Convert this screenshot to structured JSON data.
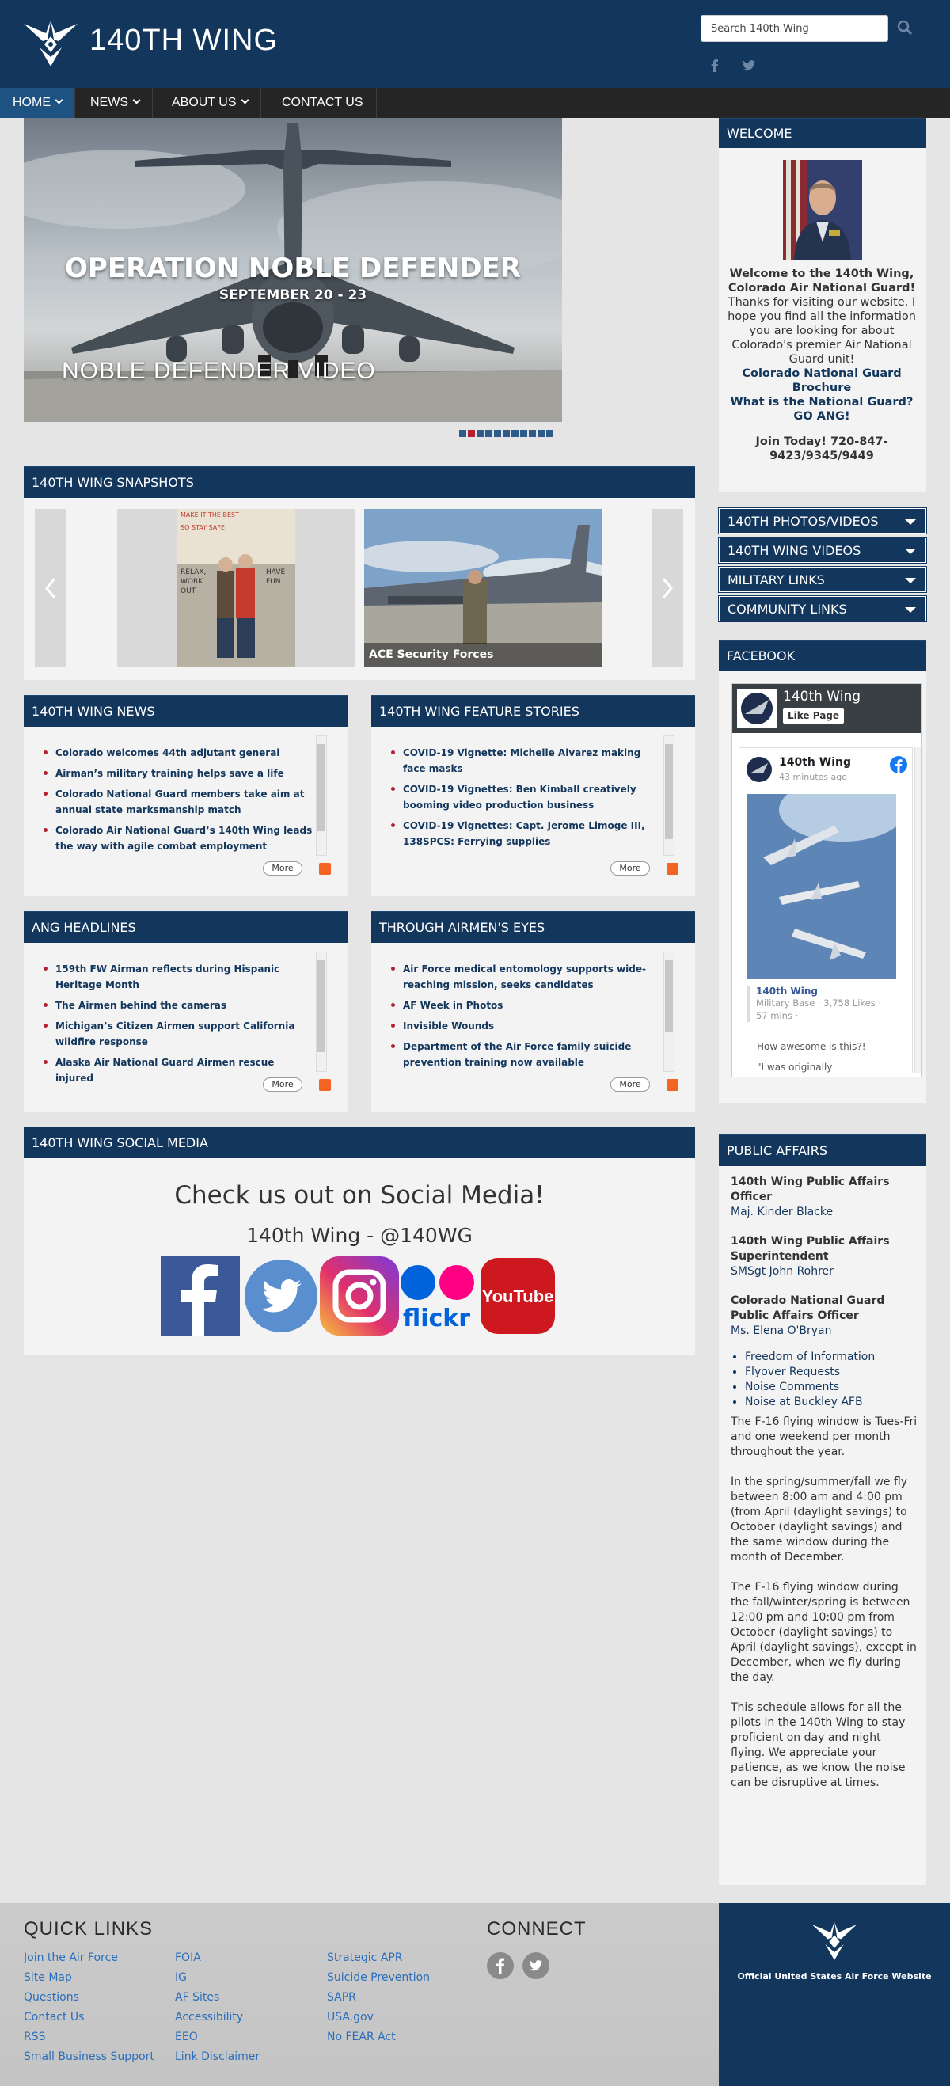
{
  "header": {
    "site_title": "140TH WING",
    "search_placeholder": "Search 140th Wing",
    "icons": [
      "air-force-logo",
      "search-icon",
      "facebook-icon",
      "twitter-icon"
    ]
  },
  "nav": {
    "items": [
      {
        "label": "HOME",
        "active": true
      },
      {
        "label": "NEWS",
        "active": false
      },
      {
        "label": "ABOUT US",
        "active": false
      },
      {
        "label": "CONTACT US",
        "active": false
      }
    ]
  },
  "hero": {
    "title": "OPERATION NOBLE DEFENDER",
    "subtitle": "SEPTEMBER 20 - 23",
    "video_label": "NOBLE DEFENDER VIDEO",
    "slide_count": 11,
    "active_slide": 2
  },
  "snapshots": {
    "heading": "140TH WING SNAPSHOTS",
    "caption": "ACE Security Forces",
    "sign_text": [
      "MAKE IT THE BEST",
      "SO STAY SAFE",
      "RELAX,",
      "WORK",
      "OUT",
      "HAVE",
      "FUN."
    ]
  },
  "news": {
    "heading": "140TH WING NEWS",
    "items": [
      "Colorado welcomes 44th adjutant general",
      "Airman’s military training helps save a life",
      "Colorado National Guard members take aim at annual state marksmanship match",
      "Colorado Air National Guard’s 140th Wing leads the way with agile combat employment"
    ],
    "more": "More"
  },
  "features": {
    "heading": "140TH WING FEATURE STORIES",
    "items": [
      "COVID-19 Vignette: Michelle Alvarez making face masks",
      "COVID-19 Vignettes: Ben Kimball creatively booming video production business",
      "COVID-19 Vignettes: Capt. Jerome Limoge III, 138SPCS: Ferrying supplies"
    ],
    "more": "More"
  },
  "ang": {
    "heading": "ANG HEADLINES",
    "items": [
      "159th FW Airman reflects during Hispanic Heritage Month",
      "The Airmen behind the cameras",
      "Michigan’s Citizen Airmen support California wildfire response",
      "Alaska Air National Guard Airmen rescue injured"
    ],
    "more": "More"
  },
  "airmen": {
    "heading": "THROUGH AIRMEN'S EYES",
    "items": [
      "Air Force medical entomology supports wide-reaching mission, seeks candidates",
      "AF Week in Photos",
      "Invisible Wounds",
      "Department of the Air Force family suicide prevention training now available"
    ],
    "more": "More"
  },
  "social": {
    "heading": "140TH WING SOCIAL MEDIA",
    "title": "Check us out on Social Media!",
    "handle": "140th Wing - @140WG",
    "networks": [
      "facebook",
      "twitter",
      "instagram",
      "flickr",
      "youtube"
    ],
    "flickr_label": "flickr",
    "youtube_label": "YouTube"
  },
  "welcome": {
    "heading": "WELCOME",
    "line1": "Welcome to the 140th Wing, Colorado Air National Guard!",
    "line2": "Thanks for visiting our website. I hope you find all the information you are looking for about Colorado's premier Air National Guard unit!",
    "link1": "Colorado National Guard Brochure",
    "link2": "What is the National Guard? GO ANG!",
    "join": "Join Today! 720-847-9423/9345/9449"
  },
  "accordions": [
    "140TH PHOTOS/VIDEOS",
    "140TH WING VIDEOS",
    "MILITARY LINKS",
    "COMMUNITY LINKS"
  ],
  "facebook": {
    "heading": "FACEBOOK",
    "page_name": "140th Wing",
    "like_label": "Like Page",
    "post_time": "43 minutes ago",
    "card_name": "140th Wing",
    "card_meta": "Military Base · 3,758 Likes ·",
    "card_time": "57 mins ·",
    "post_text": "How awesome is this?!",
    "post_quote": "\"I was originally"
  },
  "public_affairs": {
    "heading": "PUBLIC AFFAIRS",
    "officer_title": "140th Wing Public Affairs Officer",
    "officer_name": "Maj. Kinder Blacke",
    "super_title": "140th Wing Public Affairs Superintendent",
    "super_name": "SMSgt John Rohrer",
    "guard_title": "Colorado National Guard Public Affairs Officer",
    "guard_name": "Ms. Elena O'Bryan",
    "links": [
      "Freedom of Information",
      "Flyover Requests",
      "Noise Comments",
      "Noise at Buckley AFB"
    ],
    "p1": "The F-16 flying window is Tues-Fri and one weekend per month throughout the year.",
    "p2": "In the spring/summer/fall we fly between 8:00 am and 4:00 pm (from April (daylight savings) to October (daylight savings) and the same window during the month of December.",
    "p3": "The F-16 flying window during the fall/winter/spring is between 12:00 pm and 10:00 pm from October (daylight savings) to April (daylight savings), except in December, when we fly during the day.",
    "p4": "This schedule allows for all the pilots in the 140th Wing to stay proficient on day and night flying. We appreciate your patience, as we know the noise can be disruptive at times."
  },
  "footer": {
    "quick_links_title": "QUICK LINKS",
    "connect_title": "CONNECT",
    "col1": [
      "Join the Air Force",
      "Site Map",
      "Questions",
      "Contact Us",
      "RSS",
      "Small Business Support"
    ],
    "col2": [
      "FOIA",
      "IG",
      "AF Sites",
      "Accessibility",
      "EEO",
      "Link Disclaimer"
    ],
    "col3": [
      "Strategic APR",
      "Suicide Prevention",
      "SAPR",
      "USA.gov",
      "No FEAR Act"
    ],
    "af_text": "Official United States Air Force Website"
  },
  "colors": {
    "navy": "#13365d",
    "nav_bg": "#252525",
    "accent_red": "#b32031",
    "link_blue": "#2a6ebb"
  }
}
